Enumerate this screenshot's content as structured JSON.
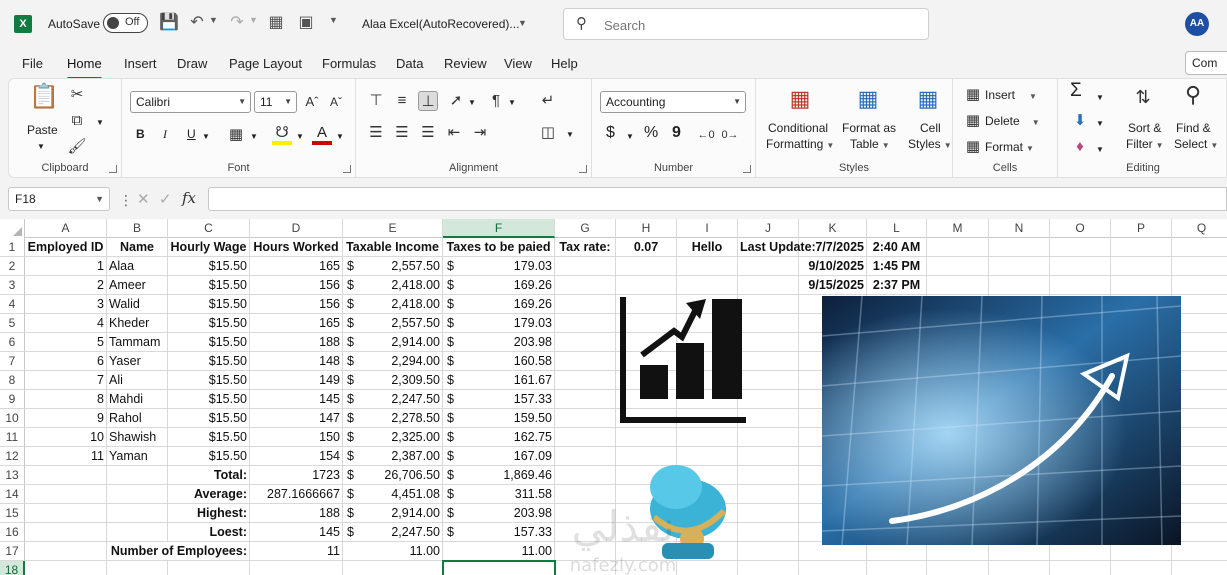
{
  "title_bar": {
    "autosave_label": "AutoSave",
    "autosave_state": "Off",
    "doc_title": "Alaa Excel(AutoRecovered)...",
    "search_placeholder": "Search",
    "user_initials": "AA"
  },
  "tabs": [
    "File",
    "Home",
    "Insert",
    "Draw",
    "Page Layout",
    "Formulas",
    "Data",
    "Review",
    "View",
    "Help"
  ],
  "active_tab": "Home",
  "comments_label": "Com",
  "ribbon": {
    "clipboard": {
      "label": "Clipboard",
      "paste": "Paste"
    },
    "font": {
      "label": "Font",
      "name": "Calibri",
      "size": "11",
      "bold": "B",
      "italic": "I",
      "underline": "U"
    },
    "alignment": {
      "label": "Alignment"
    },
    "number": {
      "label": "Number",
      "format": "Accounting",
      "currency": "$",
      "percent": "%",
      "comma": "9"
    },
    "styles": {
      "label": "Styles",
      "conditional_1": "Conditional",
      "conditional_2": "Formatting",
      "format_table_1": "Format as",
      "format_table_2": "Table",
      "cell_styles_1": "Cell",
      "cell_styles_2": "Styles"
    },
    "cells": {
      "label": "Cells",
      "insert": "Insert",
      "delete": "Delete",
      "format": "Format"
    },
    "editing": {
      "label": "Editing",
      "sort_1": "Sort &",
      "sort_2": "Filter",
      "find_1": "Find &",
      "find_2": "Select",
      "sum": "Σ"
    }
  },
  "formula_bar": {
    "name_box": "F18",
    "fx": "fx",
    "formula": ""
  },
  "columns": [
    "A",
    "B",
    "C",
    "D",
    "E",
    "F",
    "G",
    "H",
    "I",
    "J",
    "K",
    "L",
    "M",
    "N",
    "O",
    "P",
    "Q"
  ],
  "selected_column": "F",
  "rows": [
    "1",
    "2",
    "3",
    "4",
    "5",
    "6",
    "7",
    "8",
    "9",
    "10",
    "11",
    "12",
    "13",
    "14",
    "15",
    "16",
    "17",
    "18"
  ],
  "selected_row": "18",
  "headers": {
    "A": "Employed ID",
    "B": "Name",
    "C": "Hourly Wage",
    "D": "Hours Worked",
    "E": "Taxable Income",
    "F": "Taxes to be paied",
    "G": "Tax rate:",
    "H": "0.07",
    "I": "Hello",
    "J": "Last Update:"
  },
  "updates": [
    {
      "date": "7/7/2025",
      "time": "2:40 AM"
    },
    {
      "date": "9/10/2025",
      "time": "1:45 PM"
    },
    {
      "date": "9/15/2025",
      "time": "2:37 PM"
    }
  ],
  "employees": [
    {
      "id": "1",
      "name": "Alaa",
      "wage": "$15.50",
      "hours": "165",
      "income": "2,557.50",
      "tax": "179.03"
    },
    {
      "id": "2",
      "name": "Ameer",
      "wage": "$15.50",
      "hours": "156",
      "income": "2,418.00",
      "tax": "169.26"
    },
    {
      "id": "3",
      "name": "Walid",
      "wage": "$15.50",
      "hours": "156",
      "income": "2,418.00",
      "tax": "169.26"
    },
    {
      "id": "4",
      "name": "Kheder",
      "wage": "$15.50",
      "hours": "165",
      "income": "2,557.50",
      "tax": "179.03"
    },
    {
      "id": "5",
      "name": "Tammam",
      "wage": "$15.50",
      "hours": "188",
      "income": "2,914.00",
      "tax": "203.98"
    },
    {
      "id": "6",
      "name": "Yaser",
      "wage": "$15.50",
      "hours": "148",
      "income": "2,294.00",
      "tax": "160.58"
    },
    {
      "id": "7",
      "name": "Ali",
      "wage": "$15.50",
      "hours": "149",
      "income": "2,309.50",
      "tax": "161.67"
    },
    {
      "id": "8",
      "name": "Mahdi",
      "wage": "$15.50",
      "hours": "145",
      "income": "2,247.50",
      "tax": "157.33"
    },
    {
      "id": "9",
      "name": "Rahol",
      "wage": "$15.50",
      "hours": "147",
      "income": "2,278.50",
      "tax": "159.50"
    },
    {
      "id": "10",
      "name": "Shawish",
      "wage": "$15.50",
      "hours": "150",
      "income": "2,325.00",
      "tax": "162.75"
    },
    {
      "id": "11",
      "name": "Yaman",
      "wage": "$15.50",
      "hours": "154",
      "income": "2,387.00",
      "tax": "167.09"
    }
  ],
  "summary": [
    {
      "label": "Total:",
      "hours": "1723",
      "income": "26,706.50",
      "tax": "1,869.46"
    },
    {
      "label": "Average:",
      "hours": "287.1666667",
      "income": "4,451.08",
      "tax": "311.58"
    },
    {
      "label": "Highest:",
      "hours": "188",
      "income": "2,914.00",
      "tax": "203.98"
    },
    {
      "label": "Loest:",
      "hours": "145",
      "income": "2,247.50",
      "tax": "157.33"
    }
  ],
  "employee_count": {
    "label": "Number of Employees:",
    "hours": "11",
    "income": "11.00",
    "tax": "11.00"
  },
  "currency_symbol": "$",
  "watermark": {
    "arabic": "نفذلي",
    "latin": "nafezly.com"
  },
  "colors": {
    "accent": "#107c41",
    "avatar": "#1e4fa3"
  }
}
